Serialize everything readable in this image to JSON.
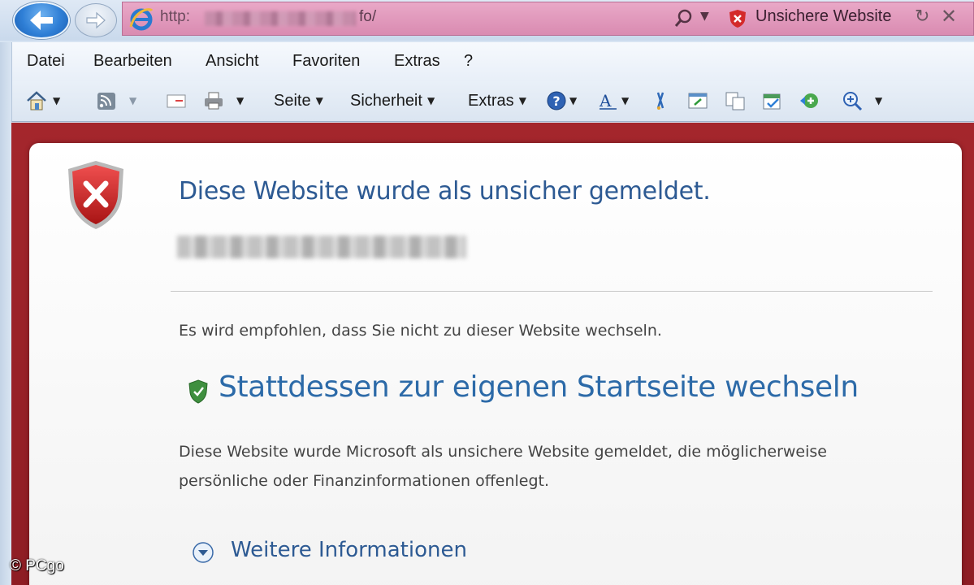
{
  "address_bar": {
    "url_prefix": "http:",
    "url_suffix": "fo/",
    "security_status": "Unsichere Website",
    "icons": [
      "back-icon",
      "forward-icon",
      "ie-logo-icon",
      "search-icon",
      "unsafe-shield-icon",
      "refresh-icon",
      "close-icon"
    ]
  },
  "menu": {
    "items": [
      "Datei",
      "Bearbeiten",
      "Ansicht",
      "Favoriten",
      "Extras",
      "?"
    ]
  },
  "commandbar": {
    "seite": "Seite",
    "sicherheit": "Sicherheit",
    "extras": "Extras",
    "icons": [
      "home-icon",
      "feeds-icon",
      "mail-icon",
      "print-icon",
      "help-icon",
      "font-icon",
      "research-icon",
      "window-icon",
      "copy-icon",
      "calendar-icon",
      "add-on-icon",
      "zoom-icon"
    ]
  },
  "warning": {
    "title": "Diese Website wurde als unsicher gemeldet.",
    "recommendation": "Es wird empfohlen, dass Sie nicht zu dieser Website wechseln.",
    "home_link": "Stattdessen zur eigenen Startseite wechseln",
    "description": "Diese Website wurde Microsoft als unsichere Website gemeldet, die möglicherweise persönliche oder Finanzinformationen offenlegt.",
    "more_info": "Weitere Informationen"
  },
  "watermark": "© PCgo",
  "colors": {
    "danger_bg": "#a4262c",
    "heading_blue": "#2d5a93",
    "link_blue": "#2c6aa8",
    "url_bar_pink": "#e9a8c7"
  }
}
